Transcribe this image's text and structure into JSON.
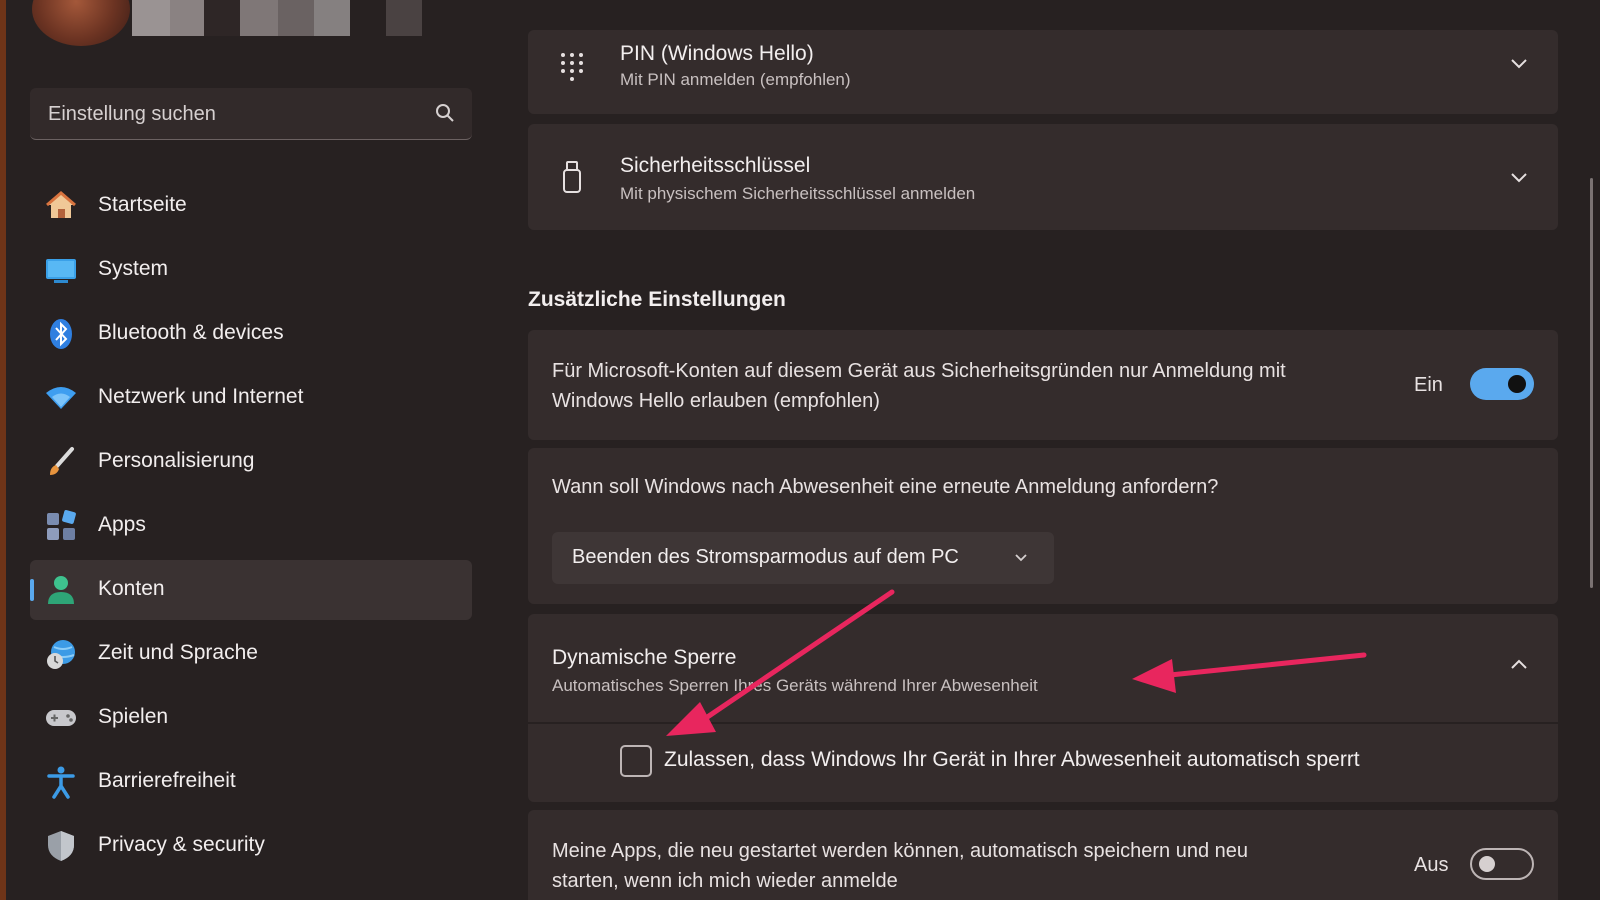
{
  "sidebar": {
    "search": {
      "placeholder": "Einstellung suchen"
    },
    "items": [
      {
        "label": "Startseite",
        "icon": "home-icon"
      },
      {
        "label": "System",
        "icon": "monitor-icon"
      },
      {
        "label": "Bluetooth & devices",
        "icon": "bluetooth-icon"
      },
      {
        "label": "Netzwerk und Internet",
        "icon": "wifi-icon"
      },
      {
        "label": "Personalisierung",
        "icon": "brush-icon"
      },
      {
        "label": "Apps",
        "icon": "apps-icon"
      },
      {
        "label": "Konten",
        "icon": "person-icon",
        "selected": true
      },
      {
        "label": "Zeit und Sprache",
        "icon": "globe-clock-icon"
      },
      {
        "label": "Spielen",
        "icon": "gamepad-icon"
      },
      {
        "label": "Barrierefreiheit",
        "icon": "accessibility-icon"
      },
      {
        "label": "Privacy & security",
        "icon": "shield-icon"
      }
    ]
  },
  "main": {
    "pin": {
      "title": "PIN (Windows Hello)",
      "subtitle": "Mit PIN anmelden (empfohlen)"
    },
    "security_key": {
      "title": "Sicherheitsschlüssel",
      "subtitle": "Mit physischem Sicherheitsschlüssel anmelden"
    },
    "section_title": "Zusätzliche Einstellungen",
    "hello_only": {
      "line1": "Für Microsoft-Konten auf diesem Gerät aus Sicherheitsgründen nur Anmeldung mit",
      "line2": "Windows Hello erlauben (empfohlen)",
      "state_label": "Ein",
      "on": true
    },
    "relogin": {
      "question": "Wann soll Windows nach Abwesenheit eine erneute Anmeldung anfordern?",
      "selected": "Beenden des Stromsparmodus auf dem PC"
    },
    "dynamic_lock": {
      "title": "Dynamische Sperre",
      "subtitle": "Automatisches Sperren Ihres Geräts während Ihrer Abwesenheit",
      "checkbox_label": "Zulassen, dass Windows Ihr Gerät in Ihrer Abwesenheit automatisch sperrt",
      "checked": false
    },
    "restart_apps": {
      "line1": "Meine Apps, die neu gestartet werden können, automatisch speichern und neu",
      "line2": "starten, wenn ich mich wieder anmelde",
      "state_label": "Aus",
      "on": false
    }
  },
  "colors": {
    "accent": "#5aa9ee",
    "annotation_arrow": "#e8265e",
    "background": "#272121",
    "card": "#342c2c"
  }
}
